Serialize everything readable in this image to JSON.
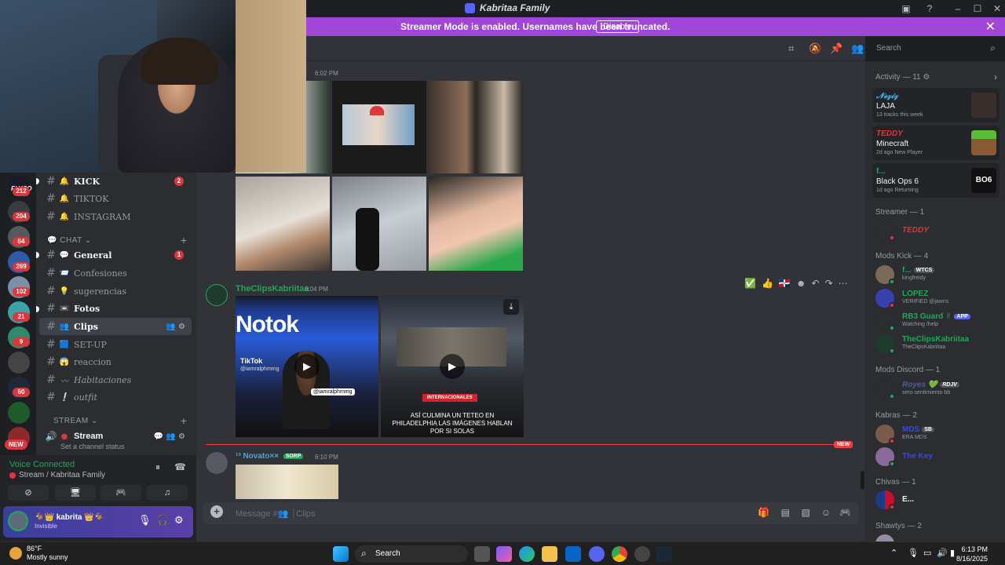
{
  "window": {
    "title": "Kabritaa Family"
  },
  "banner": {
    "message": "Streamer Mode is enabled. Usernames have been truncated.",
    "disable_label": "Disable",
    "close_glyph": "✕"
  },
  "header": {
    "search_placeholder": "Search"
  },
  "server_rail": {
    "logo_text": "FLYCO",
    "badges": [
      "212",
      "204",
      "64",
      "269",
      "102",
      "21",
      "9",
      "60"
    ],
    "new_label": "NEW"
  },
  "channels": {
    "items": [
      {
        "emoji": "🔔",
        "name": "KICK",
        "badge": "2"
      },
      {
        "emoji": "🔔",
        "name": "TIKTOK"
      },
      {
        "emoji": "🔔",
        "name": "INSTAGRAM"
      }
    ],
    "chat_category": "CHAT",
    "chat_items": [
      {
        "emoji": "💬",
        "name": "General",
        "badge": "1"
      },
      {
        "emoji": "📨",
        "name": "Confesiones"
      },
      {
        "emoji": "💡",
        "name": "sugerencias"
      },
      {
        "emoji": "📼",
        "name": "Fotos"
      },
      {
        "emoji": "👥",
        "name": "Clips"
      },
      {
        "emoji": "🟦",
        "name": "SET-UP"
      },
      {
        "emoji": "😱",
        "name": "reaccion"
      },
      {
        "emoji": "〰",
        "name": "Habitaciones"
      },
      {
        "emoji": "❕",
        "name": "outfit"
      }
    ],
    "stream_category": "STREAM",
    "stream_channel": "Stream",
    "stream_status": "Set a channel status"
  },
  "voice": {
    "status": "Voice Connected",
    "location": "Stream / Kabritaa Family"
  },
  "user": {
    "name": "kabrita",
    "status": "Invisible"
  },
  "messages": [
    {
      "time": "6:02 PM"
    },
    {
      "author": "TheClipsKabriitaa",
      "time": "6:04 PM",
      "video1_watermark": "TikTok",
      "video1_handle": "@iamralphmmg",
      "video1_banner": "Notok",
      "video2_tag": "INTERNACIONALES",
      "video2_caption": "ASÍ CULMINA UN TETEO EN PHILADELPHIA LAS IMÁGENES HABLAN POR SI SOLAS"
    },
    {
      "author": "Novato××",
      "author_prefix": "¹³",
      "tag": "SDRP",
      "time": "6:10 PM"
    }
  ],
  "new_label": "NEW",
  "composer": {
    "placeholder": "Message #👥 ┊Clips"
  },
  "members": {
    "activity_header": "Activity — 11",
    "activity_cards": [
      {
        "name": "𝓝𝓮𝔃𝓲𝔃",
        "title": "LAJA",
        "sub": "13 tracks this week",
        "color": "#4aa3df"
      },
      {
        "name": "TEDDY",
        "title": "Minecraft",
        "sub": "2d ago  New Player",
        "color": "#da373c"
      },
      {
        "name": "f...",
        "title": "Black Ops 6",
        "sub": "1d ago  Returning",
        "color": "#23a55a"
      }
    ],
    "groups": [
      {
        "header": "Streamer — 1",
        "members": [
          {
            "name": "TEDDY",
            "color": "#da373c",
            "sub": "",
            "status": "#da373c"
          }
        ]
      },
      {
        "header": "Mods Kick — 4",
        "members": [
          {
            "name": "f...",
            "color": "#23a55a",
            "tag": "WTCS",
            "sub": "kingfreidy",
            "status": "#23a55a"
          },
          {
            "name": "LOPEZ",
            "color": "#23a55a",
            "sub": "VERIFIED @jawns",
            "status": "#da373c"
          },
          {
            "name": "RB3 Guard",
            "color": "#23a55a",
            "tag": "APP",
            "sub": "Watching /help",
            "status": "#23a55a"
          },
          {
            "name": "TheClipsKabriitaa",
            "color": "#23a55a",
            "sub": "TheClipsKabriitaa",
            "status": "#23a55a"
          }
        ]
      },
      {
        "header": "Mods Discord — 1",
        "members": [
          {
            "name": "Royes",
            "color": "#4e5d94",
            "tag": "RDJV",
            "sub": "sero sentimiento bb",
            "status": "#23a55a"
          }
        ]
      },
      {
        "header": "Kabras — 2",
        "members": [
          {
            "name": "MDS",
            "color": "#3c45e0",
            "tag": "SB",
            "sub": "ERA MDS",
            "status": "#da373c"
          },
          {
            "name": "The Key",
            "color": "#3c45e0",
            "sub": "",
            "status": "#23a55a"
          }
        ]
      },
      {
        "header": "Chivas — 1",
        "members": [
          {
            "name": "E...",
            "color": "#f2f3f5",
            "sub": "",
            "status": "#da373c"
          }
        ]
      },
      {
        "header": "Shawtys — 2",
        "members": []
      }
    ]
  },
  "taskbar": {
    "temp": "86°F",
    "weather": "Mostly sunny",
    "search": "Search",
    "time": "6:13 PM",
    "date": "8/16/2025"
  }
}
